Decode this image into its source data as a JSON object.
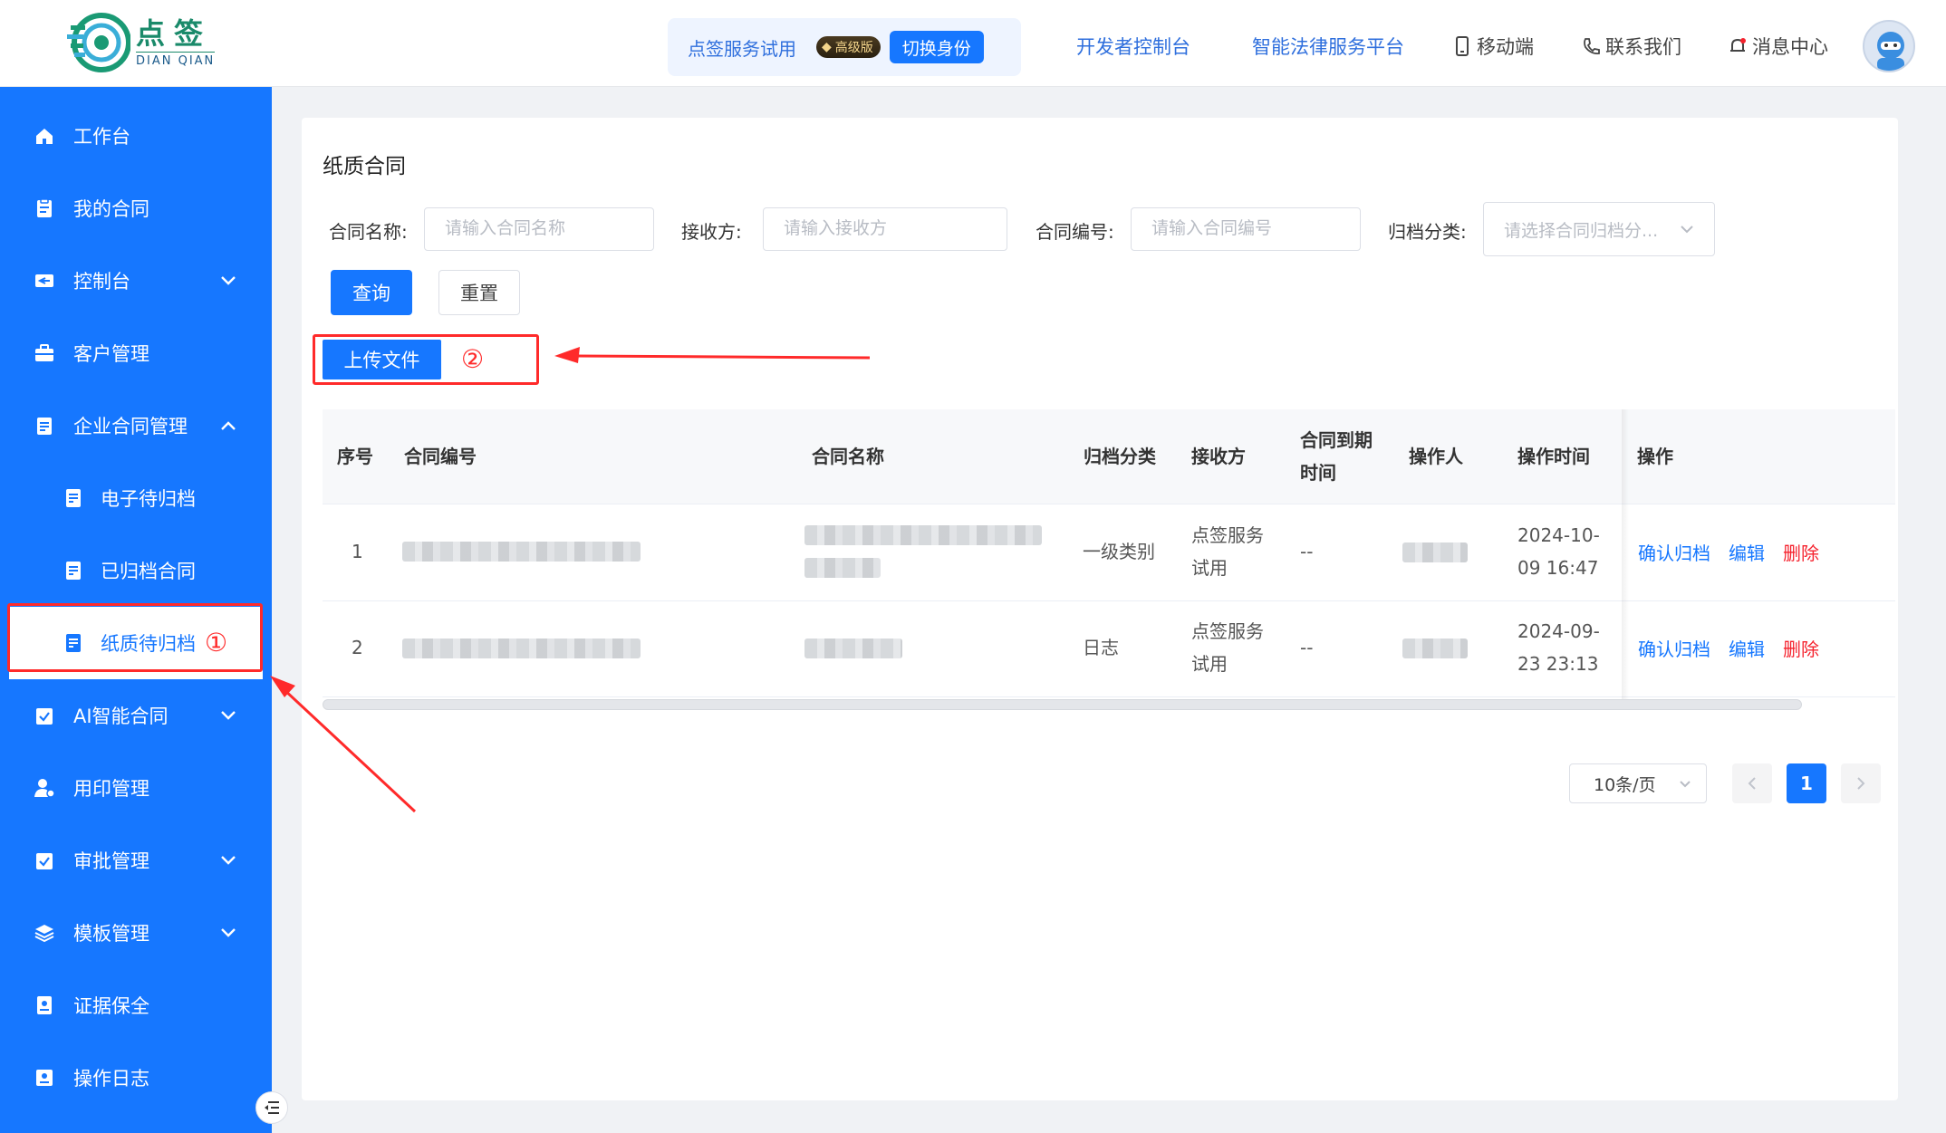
{
  "brand": {
    "name_cn": "点签",
    "name_en": "DIAN QIAN"
  },
  "identity": {
    "name": "点签服务试用",
    "tier": "高级版",
    "switch_label": "切换身份"
  },
  "topnav": {
    "developer_console": "开发者控制台",
    "legal_platform": "智能法律服务平台",
    "mobile": "移动端",
    "contact": "联系我们",
    "messages": "消息中心"
  },
  "sidebar": {
    "items": [
      {
        "label": "工作台",
        "icon": "home-icon"
      },
      {
        "label": "我的合同",
        "icon": "document-icon"
      },
      {
        "label": "控制台",
        "icon": "console-icon",
        "expandable": true
      },
      {
        "label": "客户管理",
        "icon": "briefcase-icon"
      },
      {
        "label": "企业合同管理",
        "icon": "document-icon",
        "expanded": true
      },
      {
        "label": "电子待归档",
        "icon": "file-icon"
      },
      {
        "label": "已归档合同",
        "icon": "file-icon"
      },
      {
        "label": "纸质待归档",
        "icon": "file-icon",
        "active": true
      },
      {
        "label": "AI智能合同",
        "icon": "check-clipboard-icon",
        "expandable": true
      },
      {
        "label": "用印管理",
        "icon": "seal-user-icon"
      },
      {
        "label": "审批管理",
        "icon": "check-clipboard-icon",
        "expandable": true
      },
      {
        "label": "模板管理",
        "icon": "layers-icon",
        "expandable": true
      },
      {
        "label": "证据保全",
        "icon": "evidence-icon"
      },
      {
        "label": "操作日志",
        "icon": "log-icon"
      }
    ]
  },
  "annotations": {
    "step1": "①",
    "step2": "②"
  },
  "page": {
    "title": "纸质合同"
  },
  "filters": {
    "contract_name": {
      "label": "合同名称:",
      "placeholder": "请输入合同名称"
    },
    "receiver": {
      "label": "接收方:",
      "placeholder": "请输入接收方"
    },
    "contract_no": {
      "label": "合同编号:",
      "placeholder": "请输入合同编号"
    },
    "archive_category": {
      "label": "归档分类:",
      "placeholder": "请选择合同归档分..."
    },
    "search_label": "查询",
    "reset_label": "重置"
  },
  "upload_label": "上传文件",
  "table": {
    "headers": {
      "index": "序号",
      "contract_no": "合同编号",
      "contract_name": "合同名称",
      "category": "归档分类",
      "receiver": "接收方",
      "expire_1": "合同到期",
      "expire_2": "时间",
      "operator": "操作人",
      "op_time": "操作时间",
      "actions": "操作"
    },
    "rows": [
      {
        "index": "1",
        "category": "一级类别",
        "receiver_1": "点签服务",
        "receiver_2": "试用",
        "expire": "--",
        "time_1": "2024-10-",
        "time_2": "09 16:47"
      },
      {
        "index": "2",
        "category": "日志",
        "receiver_1": "点签服务",
        "receiver_2": "试用",
        "expire": "--",
        "time_1": "2024-09-",
        "time_2": "23 23:13"
      }
    ],
    "actions": {
      "confirm": "确认归档",
      "edit": "编辑",
      "delete": "删除"
    }
  },
  "pagination": {
    "page_size": "10条/页",
    "current_page": "1"
  }
}
